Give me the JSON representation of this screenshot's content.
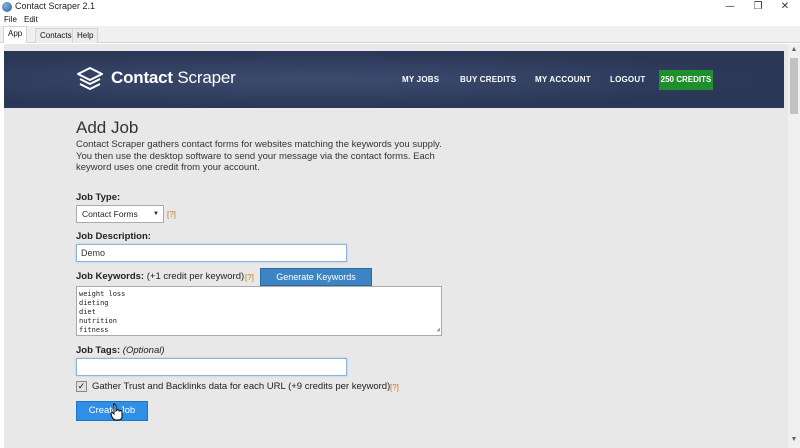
{
  "window": {
    "title": "Contact Scraper 2.1",
    "controls": {
      "minimize": "—",
      "maximize": "❐",
      "close": "✕"
    }
  },
  "menubar": {
    "items": [
      "File",
      "Edit"
    ]
  },
  "tabs": [
    {
      "label": "App",
      "active": true
    },
    {
      "label": "Contacts",
      "active": false
    },
    {
      "label": "Help",
      "active": false
    }
  ],
  "nav": {
    "logo_brand": "Contact",
    "logo_suffix": " Scraper",
    "links": [
      "MY JOBS",
      "BUY CREDITS",
      "MY ACCOUNT",
      "LOGOUT"
    ],
    "credits_badge": "250 CREDITS",
    "colors": {
      "header_bg": "#2f3d5e",
      "credits_bg": "#1f8f2e"
    }
  },
  "form": {
    "title": "Add Job",
    "intro": "Contact Scraper gathers contact forms for websites matching the keywords you supply. You then use the desktop software to send your message via the contact forms. Each keyword uses one credit from your account.",
    "job_type": {
      "label": "Job Type:",
      "selected": "Contact Forms",
      "help": "[?]"
    },
    "job_description": {
      "label": "Job Description:",
      "value": "Demo"
    },
    "job_keywords": {
      "label": "Job Keywords:",
      "sublabel": " (+1 credit per keyword)",
      "help": "[?]",
      "generate_button": "Generate Keywords",
      "lines": [
        "weight loss",
        "dieting",
        "diet",
        "nutrition",
        "fitness"
      ]
    },
    "job_tags": {
      "label": "Job Tags:",
      "optional": " (Optional)",
      "value": ""
    },
    "trust_checkbox": {
      "checked": true,
      "label": "Gather Trust and Backlinks data for each URL (+9 credits per keyword)",
      "help": "[?]"
    },
    "submit_button": "Create Job",
    "colors": {
      "submit_bg": "#2f8fe6",
      "generate_bg": "#3c84c4",
      "help_color": "#c07a1a"
    }
  }
}
